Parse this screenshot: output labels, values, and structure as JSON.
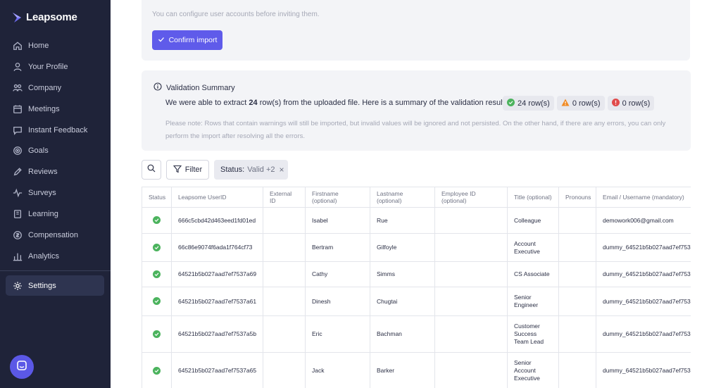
{
  "app": {
    "name": "Leapsome"
  },
  "sidebar": {
    "items": [
      {
        "label": "Home",
        "icon": "home-icon"
      },
      {
        "label": "Your Profile",
        "icon": "user-icon"
      },
      {
        "label": "Company",
        "icon": "people-icon"
      },
      {
        "label": "Meetings",
        "icon": "calendar-icon"
      },
      {
        "label": "Instant Feedback",
        "icon": "chat-icon"
      },
      {
        "label": "Goals",
        "icon": "target-icon"
      },
      {
        "label": "Reviews",
        "icon": "pencil-icon"
      },
      {
        "label": "Surveys",
        "icon": "pulse-icon"
      },
      {
        "label": "Learning",
        "icon": "book-icon"
      },
      {
        "label": "Compensation",
        "icon": "coins-icon"
      },
      {
        "label": "Analytics",
        "icon": "chart-icon"
      }
    ],
    "settings_label": "Settings"
  },
  "import_card": {
    "hint": "You can configure user accounts before inviting them.",
    "confirm_label": "Confirm import"
  },
  "validation": {
    "title": "Validation Summary",
    "text_before": "We were able to extract ",
    "row_count": "24",
    "text_after": " row(s) from the uploaded file. Here is a summary of the validation results:",
    "valid_badge": "24 row(s)",
    "warning_badge": "0 row(s)",
    "error_badge": "0 row(s)",
    "note": "Please note: Rows that contain warnings will still be imported, but invalid values will be ignored and not persisted. On the other hand, if there are any errors, you can only perform the import after resolving all the errors."
  },
  "toolbar": {
    "filter_label": "Filter",
    "status_key": "Status:",
    "status_value": "Valid +2",
    "status_clear": "×"
  },
  "table": {
    "columns": [
      "Status",
      "Leapsome UserID",
      "External ID",
      "Firstname (optional)",
      "Lastname (optional)",
      "Employee ID (optional)",
      "Title (optional)",
      "Pronouns",
      "Email / Username (mandatory)"
    ],
    "rows": [
      {
        "user_id": "666c5cbd42d463eed1fd01ed",
        "external_id": "",
        "first": "Isabel",
        "last": "Rue",
        "employee_id": "",
        "title": "Colleague",
        "pronouns": "",
        "email": "demowork006@gmail.com"
      },
      {
        "user_id": "66c86e9074f6ada1f764cf73",
        "external_id": "",
        "first": "Bertram",
        "last": "Gilfoyle",
        "employee_id": "",
        "title": "Account Executive",
        "pronouns": "",
        "email": "dummy_64521b5b027aad7ef753"
      },
      {
        "user_id": "64521b5b027aad7ef7537a69",
        "external_id": "",
        "first": "Cathy",
        "last": "Simms",
        "employee_id": "",
        "title": "CS Associate",
        "pronouns": "",
        "email": "dummy_64521b5b027aad7ef753"
      },
      {
        "user_id": "64521b5b027aad7ef7537a61",
        "external_id": "",
        "first": "Dinesh",
        "last": "Chugtai",
        "employee_id": "",
        "title": "Senior Engineer",
        "pronouns": "",
        "email": "dummy_64521b5b027aad7ef753"
      },
      {
        "user_id": "64521b5b027aad7ef7537a5b",
        "external_id": "",
        "first": "Eric",
        "last": "Bachman",
        "employee_id": "",
        "title": "Customer Success Team Lead",
        "pronouns": "",
        "email": "dummy_64521b5b027aad7ef753"
      },
      {
        "user_id": "64521b5b027aad7ef7537a65",
        "external_id": "",
        "first": "Jack",
        "last": "Barker",
        "employee_id": "",
        "title": "Senior Account Executive",
        "pronouns": "",
        "email": "dummy_64521b5b027aad7ef753"
      }
    ]
  },
  "colors": {
    "sidebar_bg": "#1f2339",
    "accent": "#5f5bea",
    "valid": "#4bb35d",
    "warning": "#f08a24",
    "error": "#e04a4a"
  }
}
